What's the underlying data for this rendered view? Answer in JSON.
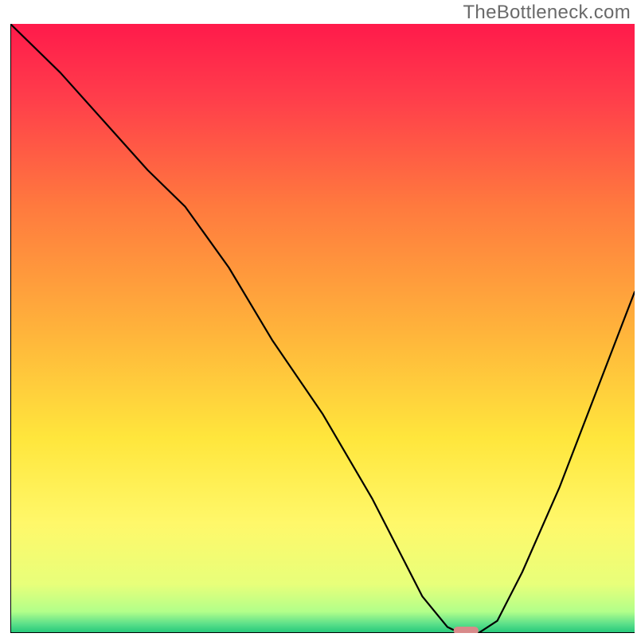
{
  "watermark": "TheBottleneck.com",
  "chart_data": {
    "type": "line",
    "title": "",
    "xlabel": "",
    "ylabel": "",
    "xlim": [
      0,
      100
    ],
    "ylim": [
      0,
      100
    ],
    "grid": false,
    "background": "red-yellow-green vertical gradient",
    "gradient_stops": [
      {
        "pos": 0,
        "color": "#ff1a4b"
      },
      {
        "pos": 0.12,
        "color": "#ff3d4b"
      },
      {
        "pos": 0.3,
        "color": "#ff7a3e"
      },
      {
        "pos": 0.5,
        "color": "#ffb23b"
      },
      {
        "pos": 0.68,
        "color": "#ffe63c"
      },
      {
        "pos": 0.82,
        "color": "#fff86a"
      },
      {
        "pos": 0.92,
        "color": "#e8ff7a"
      },
      {
        "pos": 0.965,
        "color": "#b2ff8a"
      },
      {
        "pos": 0.985,
        "color": "#5ce08a"
      },
      {
        "pos": 1.0,
        "color": "#23c77a"
      }
    ],
    "series": [
      {
        "name": "bottleneck-curve",
        "color": "#000000",
        "x": [
          0,
          8,
          15,
          22,
          28,
          35,
          42,
          50,
          58,
          62,
          66,
          70,
          72,
          75,
          78,
          82,
          88,
          94,
          100
        ],
        "y": [
          100,
          92,
          84,
          76,
          70,
          60,
          48,
          36,
          22,
          14,
          6,
          1,
          0,
          0,
          2,
          10,
          24,
          40,
          56
        ]
      }
    ],
    "marker": {
      "name": "optimal-point",
      "x": 73,
      "y": 0.4,
      "width": 4,
      "height": 1.3,
      "color": "#d88a8a"
    },
    "axes": {
      "line_color": "#000000",
      "line_width": 2
    }
  }
}
